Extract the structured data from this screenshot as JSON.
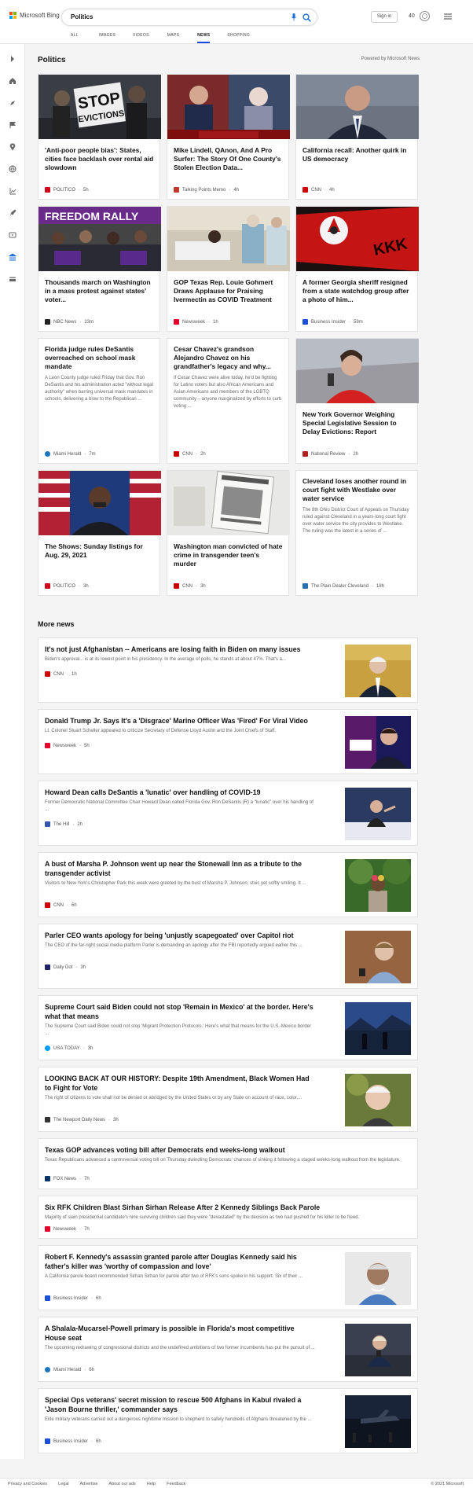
{
  "header": {
    "logo_text": "Microsoft Bing",
    "search_value": "Politics",
    "signin_label": "Sign in",
    "points": "40",
    "tabs": [
      "ALL",
      "IMAGES",
      "VIDEOS",
      "MAPS",
      "NEWS",
      "SHOPPING"
    ],
    "active_tab": "NEWS"
  },
  "sidebar": {
    "icons": [
      "expand-arrow-icon",
      "home-icon",
      "compass-icon",
      "flag-icon",
      "location-pin-icon",
      "globe-icon",
      "trend-icon",
      "rocket-icon",
      "tv-icon",
      "bank-icon",
      "card-icon"
    ]
  },
  "page": {
    "title": "Politics",
    "powered_by": "Powered by Microsoft News"
  },
  "cards": [
    {
      "title": "'Anti-poor people bias': States, cities face backlash over rental aid slowdown",
      "source": "POLITICO",
      "time": "5h",
      "icon_color": "#d0021b",
      "image": "protest-stop-evictions"
    },
    {
      "title": "Mike Lindell, QAnon, And A Pro Surfer: The Story Of One County's Stolen Election Data...",
      "source": "Talking Points Memo",
      "time": "4h",
      "icon_color": "#c0392b",
      "image": "lindell-report"
    },
    {
      "title": "California recall: Another quirk in US democracy",
      "source": "CNN",
      "time": "4h",
      "icon_color": "#cc0000",
      "image": "newsom-portrait"
    },
    {
      "title": "Thousands march on Washington in a mass protest against states' voter...",
      "source": "NBC News",
      "time": "23m",
      "icon_color": "#222222",
      "image": "freedom-rally"
    },
    {
      "title": "GOP Texas Rep. Louie Gohmert Draws Applause for Praising Ivermectin as COVID Treatment",
      "source": "Newsweek",
      "time": "1h",
      "icon_color": "#e4002b",
      "image": "hospital-ward"
    },
    {
      "title": "A former Georgia sheriff resigned from a state watchdog group after a photo of him...",
      "source": "Business Insider",
      "time": "59m",
      "icon_color": "#1a4fd6",
      "image": "kkk-flag"
    },
    {
      "title": "Florida judge rules DeSantis overreached on school mask mandate",
      "snippet": "A Leon County judge ruled Friday that Gov. Ron DeSantis and his administration acted \"without legal authority\" when barring universal mask mandates in schools, delivering a blow to the Republican ...",
      "source": "Miami Herald",
      "time": "7m",
      "icon_color": "#1b75bb"
    },
    {
      "title": "Cesar Chavez's grandson Alejandro Chavez on his grandfather's legacy and why...",
      "snippet": "If Cesar Chavez were alive today, he'd be fighting for Latino voters but also African Americans and Asian Americans and members of the LGBTQ community – anyone marginalized by efforts to curb voting ...",
      "source": "CNN",
      "time": "2h",
      "icon_color": "#cc0000"
    },
    {
      "title": "New York Governor Weighing Special Legislative Session to Delay Evictions: Report",
      "source": "National Review",
      "time": "2h",
      "icon_color": "#b22222",
      "image": "hochul-podium"
    },
    {
      "title": "The Shows: Sunday listings for Aug. 29, 2021",
      "source": "POLITICO",
      "time": "3h",
      "icon_color": "#d0021b",
      "image": "clyburn-flags"
    },
    {
      "title": "Washington man convicted of hate crime in transgender teen's murder",
      "source": "CNN",
      "time": "3h",
      "icon_color": "#cc0000",
      "image": "missing-poster"
    },
    {
      "title": "Cleveland loses another round in court fight with Westlake over water service",
      "snippet": "The 8th Ohio District Court of Appeals on Thursday ruled against Cleveland in a years-long court fight over water service the city provides to Westlake. The ruling was the latest in a series of ...",
      "source": "The Plain Dealer Cleveland",
      "time": "18h",
      "icon_color": "#2a6fb0"
    }
  ],
  "more_news_title": "More news",
  "more_news": [
    {
      "title": "It's not just Afghanistan -- Americans are losing faith in Biden on many issues",
      "snippet": "Biden's approval... is at its lowest point in his presidency. In the average of polls, he stands at about 47%. That's a...",
      "source": "CNN",
      "time": "1h",
      "icon_color": "#cc0000",
      "thumb": "biden"
    },
    {
      "title": "Donald Trump Jr. Says It's a 'Disgrace' Marine Officer Was 'Fired' For Viral Video",
      "snippet": "Lt. Colonel Stuart Scheller appeared to criticize Secretary of Defense Lloyd Austin and the Joint Chiefs of Staff.",
      "source": "Newsweek",
      "time": "5h",
      "icon_color": "#e4002b",
      "thumb": "cpac"
    },
    {
      "title": "Howard Dean calls DeSantis a 'lunatic' over handling of COVID-19",
      "snippet": "Former Democratic National Committee Chair Howard Dean called Florida Gov. Ron DeSantis (R) a \"lunatic\" over his handling of ...",
      "source": "The Hill",
      "time": "2h",
      "icon_color": "#3355aa",
      "thumb": "stage"
    },
    {
      "title": "A bust of Marsha P. Johnson went up near the Stonewall Inn as a tribute to the transgender activist",
      "snippet": "Visitors to New York's Christopher Park this week were greeted by the bust of Marsha P. Johnson, stoic yet softly smiling. It ...",
      "source": "CNN",
      "time": "6h",
      "icon_color": "#cc0000",
      "thumb": "park"
    },
    {
      "title": "Parler CEO wants apology for being 'unjustly scapegoated' over Capitol riot",
      "snippet": "The CEO of the far-right social media platform Parler is demanding an apology after the FBI reportedly argued earlier this ...",
      "source": "Daily Dot",
      "time": "3h",
      "icon_color": "#222266",
      "thumb": "parler"
    },
    {
      "title": "Supreme Court said Biden could not stop 'Remain in Mexico' at the border. Here's what that means",
      "snippet": "The Supreme Court said Biden could not stop 'Migrant Protection Protocols.' Here's what that means for the U.S.-Mexico border ...",
      "source": "USA TODAY",
      "time": "3h",
      "icon_color": "#009bff",
      "thumb": "border"
    },
    {
      "title": "LOOKING BACK AT OUR HISTORY: Despite 19th Amendment, Black Women Had to Fight for Vote",
      "snippet": "The right of citizens to vote shall not be denied or abridged by the United States or by any State on account of race, color,...",
      "source": "The Newport Daily News",
      "time": "3h",
      "icon_color": "#333333",
      "thumb": "man"
    },
    {
      "title": "Texas GOP advances voting bill after Democrats end weeks-long walkout",
      "snippet": "Texas Republicans advanced a controversial voting bill on Thursday dwindling Democrats' chances of sinking it following a staged weeks-long walkout from the legislature.",
      "source": "FOX News",
      "time": "7h",
      "icon_color": "#003366"
    },
    {
      "title": "Six RFK Children Blast Sirhan Sirhan Release After 2 Kennedy Siblings Back Parole",
      "snippet": "Majority of slain presidential candidate's nine surviving children said they were \"devastated\" by the decision as two had pushed for his killer to be freed.",
      "source": "Newsweek",
      "time": "7h",
      "icon_color": "#e4002b"
    },
    {
      "title": "Robert F. Kennedy's assassin granted parole after Douglas Kennedy said his father's killer was 'worthy of compassion and love'",
      "snippet": "A California parole board recommended Sirhan Sirhan for parole after two of RFK's sons spoke in his support. Six of their ...",
      "source": "Business Insider",
      "time": "6h",
      "icon_color": "#1a4fd6",
      "thumb": "sirhan"
    },
    {
      "title": "A Shalala-Mucarsel-Powell primary is possible in Florida's most competitive House seat",
      "snippet": "The upcoming redrawing of congressional districts and the undefined ambitions of two former incumbents has put the pursuit of ...",
      "source": "Miami Herald",
      "time": "6h",
      "icon_color": "#1b75bb",
      "thumb": "speaker"
    },
    {
      "title": "Special Ops veterans' secret mission to rescue 500 Afghans in Kabul rivaled a 'Jason Bourne thriller,' commander says",
      "snippet": "Elite military veterans carried out a dangerous nighttime mission to shepherd to safety hundreds of Afghans threatened by the ...",
      "source": "Business Insider",
      "time": "6h",
      "icon_color": "#1a4fd6",
      "thumb": "plane"
    }
  ],
  "footer": {
    "links": [
      "Privacy and Cookies",
      "Legal",
      "Advertise",
      "About our ads",
      "Help",
      "Feedback"
    ],
    "copyright": "© 2021 Microsoft"
  }
}
